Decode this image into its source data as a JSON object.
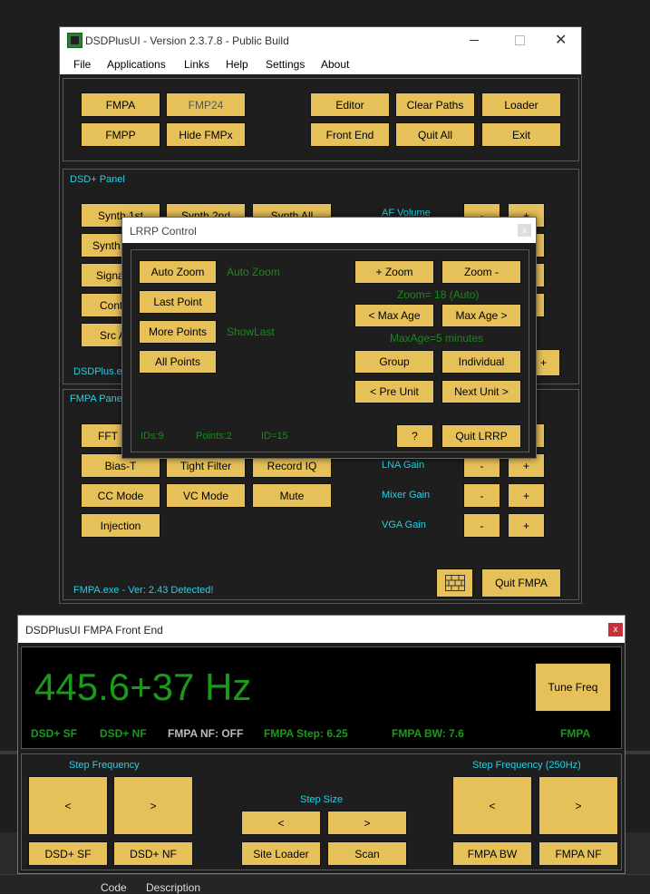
{
  "main": {
    "title": "DSDPlusUI - Version 2.3.7.8 - Public Build",
    "menu": [
      "File",
      "Applications",
      "Links",
      "Help",
      "Settings",
      "About"
    ],
    "top_buttons": {
      "fmpa": "FMPA",
      "fmp24": "FMP24",
      "fmpp": "FMPP",
      "hide_fmpx": "Hide FMPx",
      "editor": "Editor",
      "clear_paths": "Clear Paths",
      "loader": "Loader",
      "front_end": "Front End",
      "quit_all": "Quit All",
      "exit": "Exit"
    },
    "dsd_panel": {
      "title": "DSD+ Panel",
      "synth_1st": "Synth 1st",
      "synth_2nd": "Synth 2nd",
      "synth_all": "Synth All",
      "synth_partial": "Synth",
      "signal_partial": "Signa",
      "cont_partial": "Cont",
      "src_partial": "Src A",
      "af_volume": "AF Volume",
      "minus": "-",
      "plus": "+",
      "status": "DSDPlus.ex",
      "partial_plus": "+"
    },
    "fmpa_panel": {
      "title": "FMPA Panel",
      "fft_partial": "FFT M",
      "bias_t": "Bias-T",
      "tight_filter": "Tight Filter",
      "record_iq": "Record IQ",
      "cc_mode": "CC Mode",
      "vc_mode": "VC Mode",
      "mute": "Mute",
      "injection": "Injection",
      "lna_gain": "LNA Gain",
      "mixer_gain": "Mixer Gain",
      "vga_gain": "VGA Gain",
      "minus": "-",
      "plus": "+",
      "status": "FMPA.exe - Ver: 2.43 Detected!",
      "quit_fmpa": "Quit FMPA"
    }
  },
  "lrrp": {
    "title": "LRRP Control",
    "close": "x",
    "auto_zoom": "Auto Zoom",
    "auto_zoom_label": "Auto Zoom",
    "last_point": "Last Point",
    "more_points": "More Points",
    "show_last_label": "ShowLast",
    "all_points": "All Points",
    "zoom_in": "+ Zoom",
    "zoom_out": "Zoom -",
    "zoom_status": "Zoom= 18 (Auto)",
    "max_age_dec": "< Max Age",
    "max_age_inc": "Max Age >",
    "max_age_status": "MaxAge=5 minutes",
    "group": "Group",
    "individual": "Individual",
    "pre_unit": "< Pre Unit",
    "next_unit": "Next Unit >",
    "ids": "IDs:9",
    "points": "Points:2",
    "id": "ID=15",
    "help": "?",
    "quit": "Quit LRRP"
  },
  "frontend": {
    "title": "DSDPlusUI FMPA Front End",
    "close": "x",
    "frequency": "445.6+37 Hz",
    "tune_freq": "Tune Freq",
    "status": {
      "dsd_sf": "DSD+ SF",
      "dsd_nf": "DSD+ NF",
      "fmpa_nf": "FMPA NF: OFF",
      "fmpa_step": "FMPA Step: 6.25",
      "fmpa_bw": "FMPA BW: 7.6",
      "fmpa": "FMPA"
    },
    "step_frequency": "Step Frequency",
    "step_frequency_250": "Step Frequency (250Hz)",
    "step_size": "Step Size",
    "left": "<",
    "right": ">",
    "dsd_sf_btn": "DSD+ SF",
    "dsd_nf_btn": "DSD+ NF",
    "site_loader": "Site Loader",
    "scan": "Scan",
    "fmpa_bw_btn": "FMPA BW",
    "fmpa_nf_btn": "FMPA NF"
  },
  "background": {
    "code": "Code",
    "description": "Description"
  },
  "colors": {
    "button": "#e6c15a",
    "panel_label": "#22d3e6",
    "status_green": "#1aa31a",
    "freq_green": "#1a9a1a",
    "background": "#1e1e1e"
  }
}
